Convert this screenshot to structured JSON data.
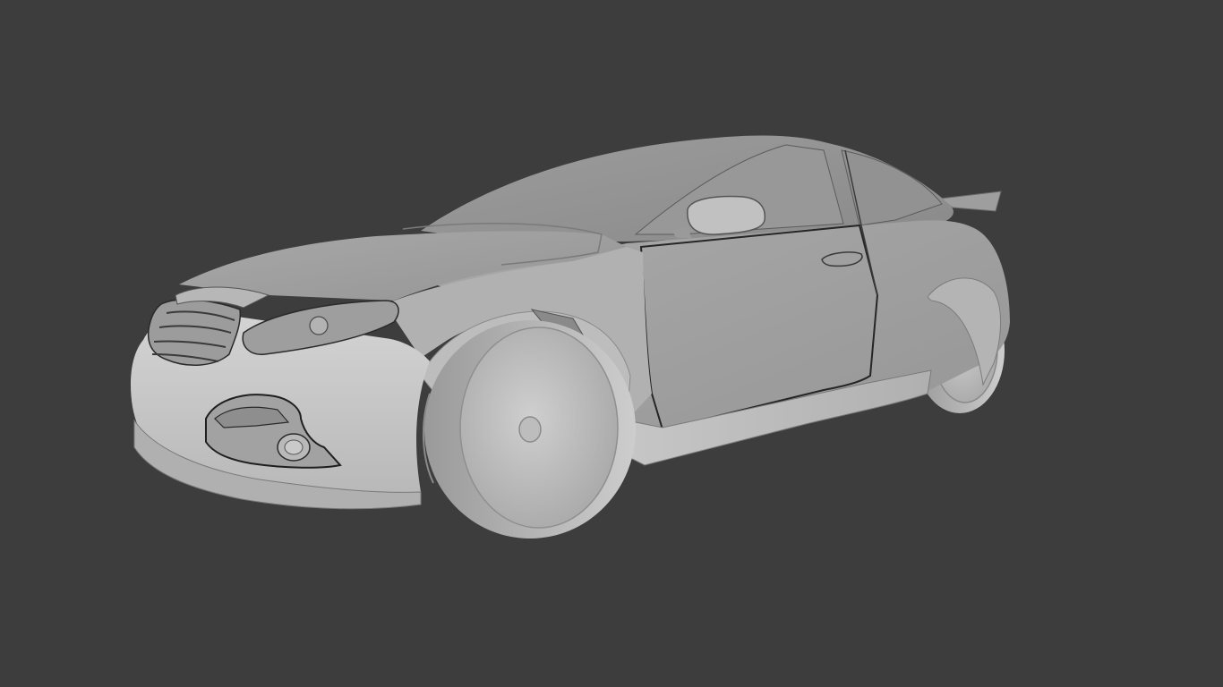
{
  "viewport": {
    "background_color": "#3d3d3d",
    "subject": "car-3d-model",
    "shading": "matcap-clay-grey"
  },
  "colors": {
    "body_light": "#c9c9c9",
    "body_mid": "#a3a3a3",
    "body_dark": "#6e6e6e",
    "crease": "#2a2a2a",
    "wheel_face": "#bdbdbd",
    "wheel_rim": "#8f8f8f"
  }
}
